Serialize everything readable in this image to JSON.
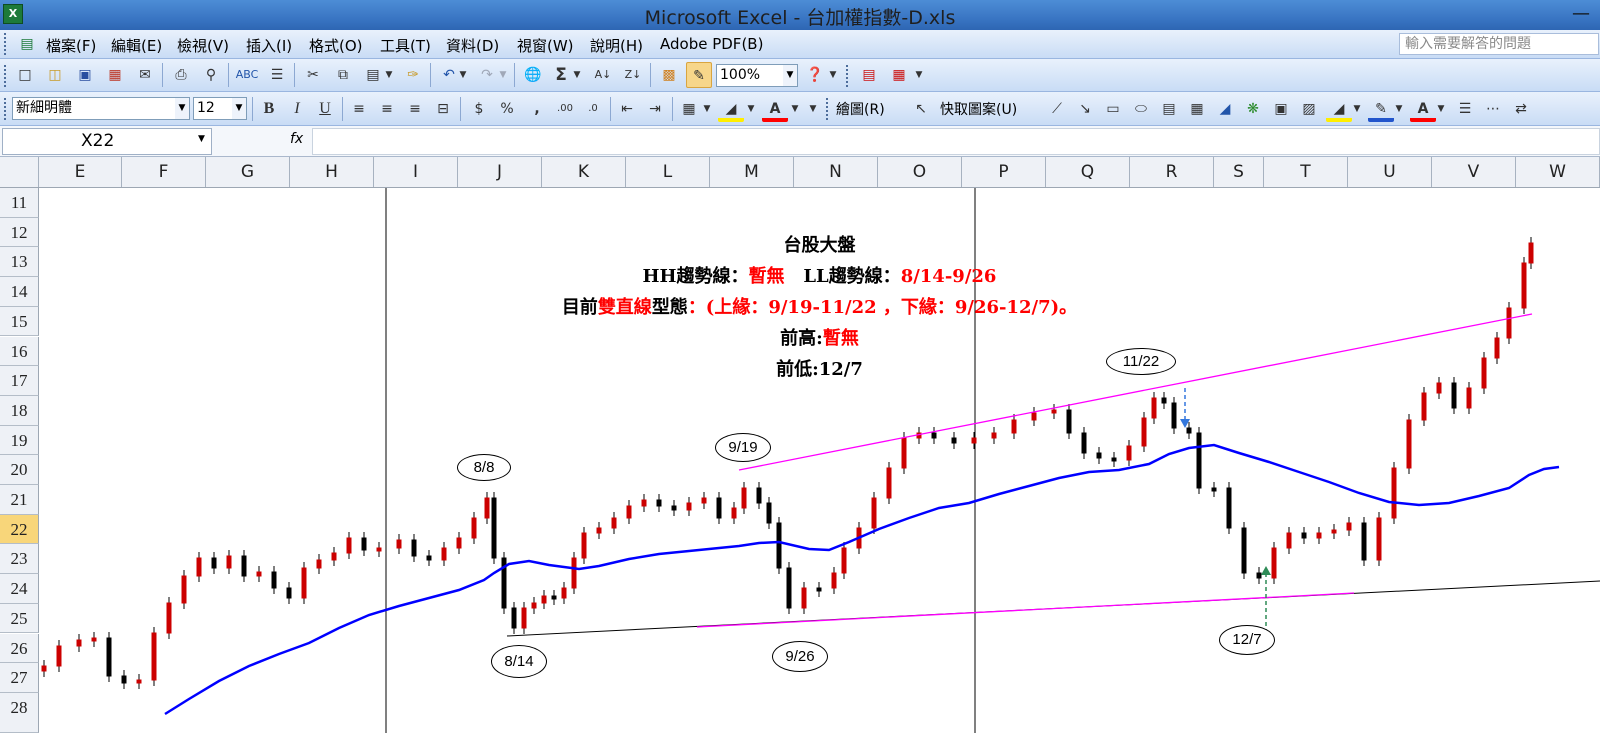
{
  "window": {
    "title": "Microsoft Excel - 台加權指數-D.xls",
    "app_icon": "X"
  },
  "menu": [
    "檔案(F)",
    "編輯(E)",
    "檢視(V)",
    "插入(I)",
    "格式(O)",
    "工具(T)",
    "資料(D)",
    "視窗(W)",
    "說明(H)",
    "Adobe PDF(B)"
  ],
  "help_placeholder": "輸入需要解答的問題",
  "toolbar": {
    "zoom": "100%",
    "font": "新細明體",
    "font_size": "12",
    "draw_label": "繪圖(R)",
    "autoshape_label": "快取圖案(U)"
  },
  "formula_bar": {
    "cell_ref": "X22",
    "fx": "fx",
    "content": ""
  },
  "columns": [
    "E",
    "F",
    "G",
    "H",
    "I",
    "J",
    "K",
    "L",
    "M",
    "N",
    "O",
    "P",
    "Q",
    "R",
    "S",
    "T",
    "U",
    "V",
    "W"
  ],
  "rows": [
    "11",
    "12",
    "13",
    "14",
    "15",
    "16",
    "17",
    "18",
    "19",
    "20",
    "21",
    "22",
    "23",
    "24",
    "25",
    "26",
    "27",
    "28"
  ],
  "selected_row": "22",
  "chart_text": {
    "title": "台股大盤",
    "line2_a": "HH趨勢線：",
    "line2_b": "暫無",
    "line2_c": "LL趨勢線：",
    "line2_d": "8/14-9/26",
    "line3_a": "目前",
    "line3_b": "雙直線",
    "line3_c": "型態",
    "line3_d": "：(上緣：9/19-11/22 ，下緣：9/26-12/7)。",
    "line4_a": "前高:",
    "line4_b": "暫無",
    "line5": "前低:12/7"
  },
  "callouts": [
    "8/8",
    "8/14",
    "9/19",
    "9/26",
    "11/22",
    "12/7"
  ],
  "colors": {
    "up_candle": "#cc0000",
    "down_candle": "#000000",
    "moving_average": "#0000ff",
    "upper_trendline": "#ff00ff",
    "lower_trendline": "#000000",
    "arrow_down": "#3377dd",
    "arrow_up": "#2e8b57"
  }
}
